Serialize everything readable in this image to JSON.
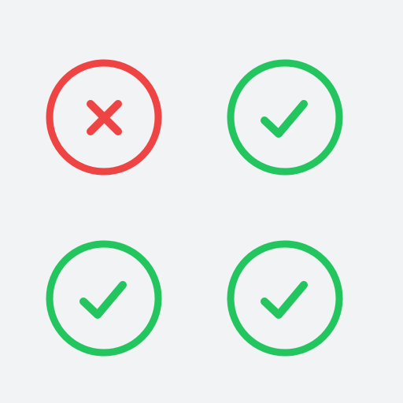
{
  "colors": {
    "background": "#f1f3f5",
    "error": "#ef4444",
    "success": "#22c55e"
  },
  "status_grid": {
    "items": [
      {
        "state": "error",
        "icon": "x-mark-icon"
      },
      {
        "state": "success",
        "icon": "checkmark-icon"
      },
      {
        "state": "success",
        "icon": "checkmark-icon"
      },
      {
        "state": "success",
        "icon": "checkmark-icon"
      }
    ]
  }
}
